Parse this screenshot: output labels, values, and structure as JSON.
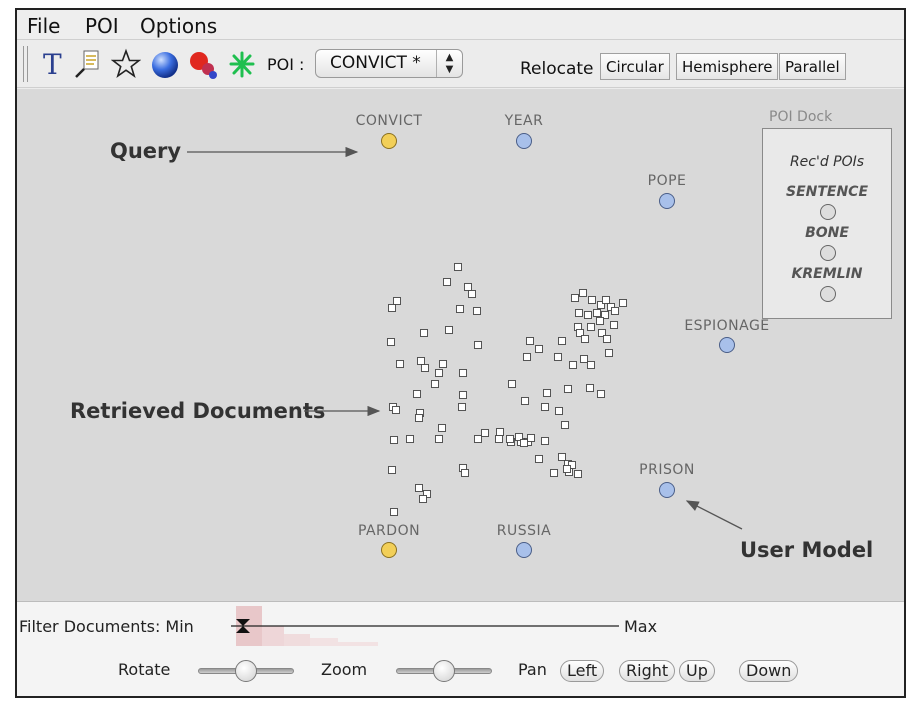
{
  "menu": [
    "File",
    "POI",
    "Options"
  ],
  "toolbar": {
    "tools": [
      {
        "name": "text-tool-icon"
      },
      {
        "name": "document-search-icon"
      },
      {
        "name": "star-icon"
      },
      {
        "name": "sphere-icon"
      },
      {
        "name": "cluster-icon"
      },
      {
        "name": "burst-icon"
      }
    ],
    "poi_label": "POI :",
    "poi_selected": "CONVICT *",
    "relocate_label": "Relocate",
    "relocate_buttons": [
      "Circular",
      "Hemisphere",
      "Parallel"
    ]
  },
  "canvas": {
    "nodes": [
      {
        "label": "CONVICT",
        "kind": "query"
      },
      {
        "label": "YEAR",
        "kind": "user"
      },
      {
        "label": "POPE",
        "kind": "user"
      },
      {
        "label": "ESPIONAGE",
        "kind": "user"
      },
      {
        "label": "PRISON",
        "kind": "user"
      },
      {
        "label": "PARDON",
        "kind": "query"
      },
      {
        "label": "RUSSIA",
        "kind": "user"
      }
    ],
    "annotations": {
      "query": "Query",
      "retrieved": "Retrieved Documents",
      "user_model": "User Model"
    },
    "dock": {
      "title": "POI Dock",
      "subtitle": "Rec'd POIs",
      "items": [
        "SENTENCE",
        "BONE",
        "KREMLIN"
      ]
    },
    "colors": {
      "query_node": "#f2cf58",
      "user_node": "#a8c0ea",
      "canvas_bg": "#d9d9d9"
    }
  },
  "bottom": {
    "filter_label": "Filter Documents: Min",
    "max_label": "Max",
    "rotate_label": "Rotate",
    "zoom_label": "Zoom",
    "pan_label": "Pan",
    "pan_buttons": [
      "Left",
      "Right",
      "Up",
      "Down"
    ]
  }
}
